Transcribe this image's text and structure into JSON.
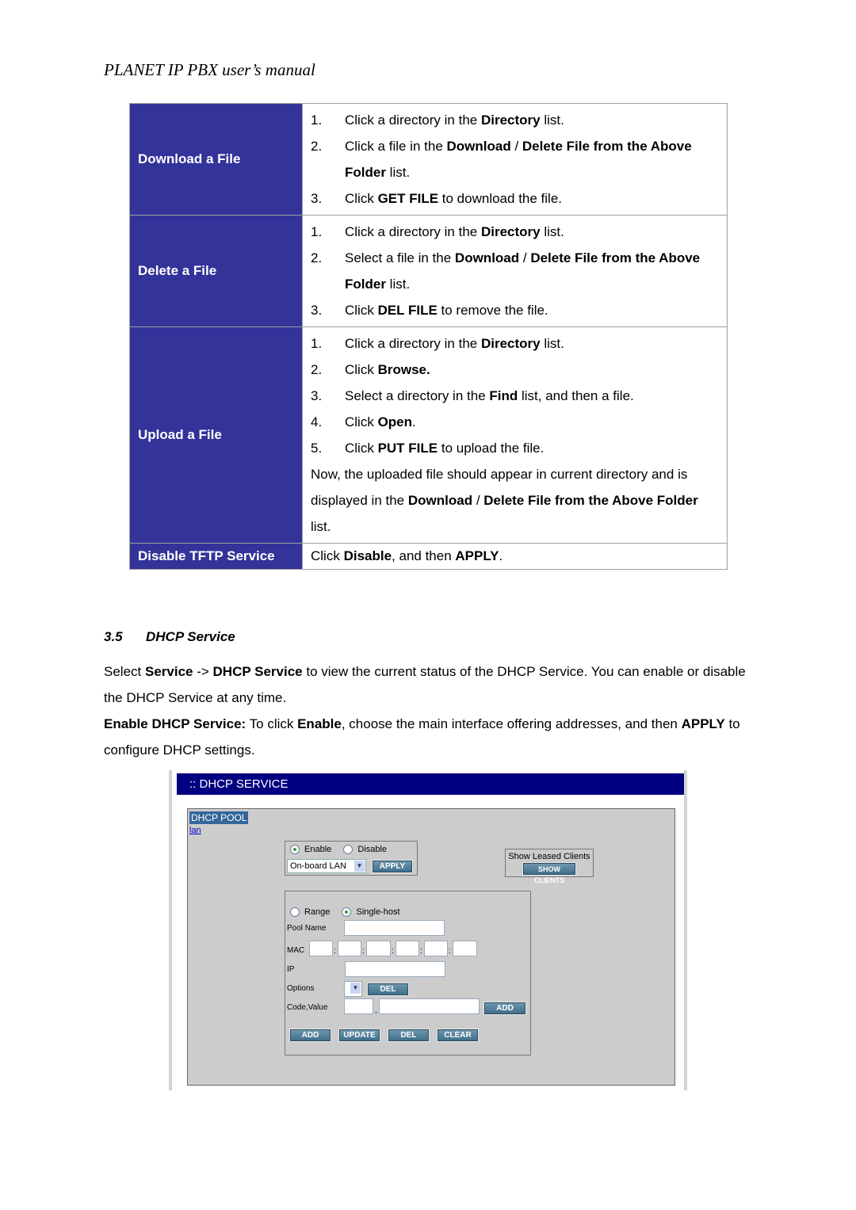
{
  "header": {
    "title": "PLANET IP PBX user’s manual"
  },
  "table": {
    "rows": [
      {
        "label": "Download a File",
        "steps": [
          {
            "num": "1.",
            "parts": [
              "Click a directory in the ",
              "Directory",
              " list."
            ]
          },
          {
            "num": "2.",
            "parts": [
              "Click a file in the ",
              "Download",
              " / ",
              "Delete File from the Above Folder",
              " list."
            ]
          },
          {
            "num": "3.",
            "parts": [
              "Click ",
              "GET FILE",
              " to download the file."
            ]
          }
        ]
      },
      {
        "label": "Delete a File",
        "steps": [
          {
            "num": "1.",
            "parts": [
              "Click a directory in the ",
              "Directory",
              " list."
            ]
          },
          {
            "num": "2.",
            "parts": [
              "Select a file in the ",
              "Download",
              " / ",
              "Delete File from the Above Folder",
              " list."
            ]
          },
          {
            "num": "3.",
            "parts": [
              "Click ",
              "DEL FILE",
              " to remove the file."
            ]
          }
        ]
      },
      {
        "label": "Upload a File",
        "steps": [
          {
            "num": "1.",
            "parts": [
              "Click a directory in the ",
              "Directory",
              " list."
            ]
          },
          {
            "num": "2.",
            "parts": [
              "Click ",
              "Browse.",
              ""
            ]
          },
          {
            "num": "3.",
            "parts": [
              "Select a directory in the ",
              "Find",
              " list, and then a file."
            ]
          },
          {
            "num": "4.",
            "parts": [
              "Click ",
              "Open",
              "."
            ]
          },
          {
            "num": "5.",
            "parts": [
              "Click ",
              "PUT FILE",
              " to upload the file."
            ]
          }
        ],
        "note": [
          "Now, the uploaded file should appear in current directory and is displayed in the ",
          "Download",
          " / ",
          "Delete File from the Above Folder",
          " list."
        ]
      },
      {
        "label": "Disable TFTP Service",
        "text": [
          "Click ",
          "Disable",
          ", and then ",
          "APPLY",
          "."
        ]
      }
    ]
  },
  "section": {
    "number": "3.5",
    "title": "DHCP Service",
    "para1": [
      "Select ",
      "Service",
      " -> ",
      "DHCP Service",
      " to view the current status of the DHCP Service. You can enable or disable the DHCP Service at any time."
    ],
    "para2": [
      "Enable DHCP Service:",
      " To click ",
      "Enable",
      ", choose the main interface offering addresses, and then ",
      "APPLY",
      " to configure DHCP settings."
    ]
  },
  "screenshot": {
    "title": ":: DHCP SERVICE",
    "pool_title": "DHCP POOL",
    "pool_link": "lan",
    "enable_label": "Enable",
    "disable_label": "Disable",
    "enable_selected": true,
    "interface_value": "On-board LAN",
    "apply_label": "APPLY",
    "show_leased_label": "Show Leased Clients",
    "show_clients_label": "SHOW CLIENTS",
    "range_label": "Range",
    "single_host_label": "Single-host",
    "single_host_selected": true,
    "pool_name_label": "Pool Name",
    "pool_name_value": "",
    "mac_label": "MAC",
    "ip_label": "IP",
    "options_label": "Options",
    "options_del_label": "DEL",
    "code_value_label": "Code,Value",
    "code_add_label": "ADD",
    "buttons": [
      "ADD",
      "UPDATE",
      "DEL",
      "CLEAR"
    ]
  }
}
